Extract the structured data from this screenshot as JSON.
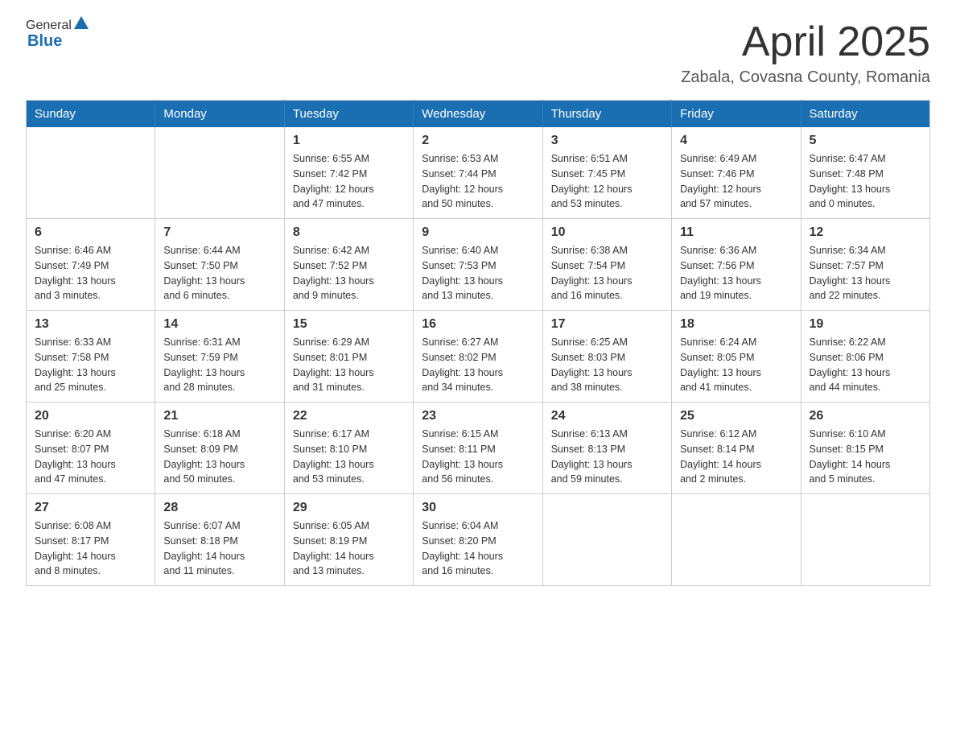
{
  "header": {
    "logo_general": "General",
    "logo_blue": "Blue",
    "month_title": "April 2025",
    "location": "Zabala, Covasna County, Romania"
  },
  "calendar": {
    "days_of_week": [
      "Sunday",
      "Monday",
      "Tuesday",
      "Wednesday",
      "Thursday",
      "Friday",
      "Saturday"
    ],
    "weeks": [
      [
        {
          "day": "",
          "info": ""
        },
        {
          "day": "",
          "info": ""
        },
        {
          "day": "1",
          "info": "Sunrise: 6:55 AM\nSunset: 7:42 PM\nDaylight: 12 hours\nand 47 minutes."
        },
        {
          "day": "2",
          "info": "Sunrise: 6:53 AM\nSunset: 7:44 PM\nDaylight: 12 hours\nand 50 minutes."
        },
        {
          "day": "3",
          "info": "Sunrise: 6:51 AM\nSunset: 7:45 PM\nDaylight: 12 hours\nand 53 minutes."
        },
        {
          "day": "4",
          "info": "Sunrise: 6:49 AM\nSunset: 7:46 PM\nDaylight: 12 hours\nand 57 minutes."
        },
        {
          "day": "5",
          "info": "Sunrise: 6:47 AM\nSunset: 7:48 PM\nDaylight: 13 hours\nand 0 minutes."
        }
      ],
      [
        {
          "day": "6",
          "info": "Sunrise: 6:46 AM\nSunset: 7:49 PM\nDaylight: 13 hours\nand 3 minutes."
        },
        {
          "day": "7",
          "info": "Sunrise: 6:44 AM\nSunset: 7:50 PM\nDaylight: 13 hours\nand 6 minutes."
        },
        {
          "day": "8",
          "info": "Sunrise: 6:42 AM\nSunset: 7:52 PM\nDaylight: 13 hours\nand 9 minutes."
        },
        {
          "day": "9",
          "info": "Sunrise: 6:40 AM\nSunset: 7:53 PM\nDaylight: 13 hours\nand 13 minutes."
        },
        {
          "day": "10",
          "info": "Sunrise: 6:38 AM\nSunset: 7:54 PM\nDaylight: 13 hours\nand 16 minutes."
        },
        {
          "day": "11",
          "info": "Sunrise: 6:36 AM\nSunset: 7:56 PM\nDaylight: 13 hours\nand 19 minutes."
        },
        {
          "day": "12",
          "info": "Sunrise: 6:34 AM\nSunset: 7:57 PM\nDaylight: 13 hours\nand 22 minutes."
        }
      ],
      [
        {
          "day": "13",
          "info": "Sunrise: 6:33 AM\nSunset: 7:58 PM\nDaylight: 13 hours\nand 25 minutes."
        },
        {
          "day": "14",
          "info": "Sunrise: 6:31 AM\nSunset: 7:59 PM\nDaylight: 13 hours\nand 28 minutes."
        },
        {
          "day": "15",
          "info": "Sunrise: 6:29 AM\nSunset: 8:01 PM\nDaylight: 13 hours\nand 31 minutes."
        },
        {
          "day": "16",
          "info": "Sunrise: 6:27 AM\nSunset: 8:02 PM\nDaylight: 13 hours\nand 34 minutes."
        },
        {
          "day": "17",
          "info": "Sunrise: 6:25 AM\nSunset: 8:03 PM\nDaylight: 13 hours\nand 38 minutes."
        },
        {
          "day": "18",
          "info": "Sunrise: 6:24 AM\nSunset: 8:05 PM\nDaylight: 13 hours\nand 41 minutes."
        },
        {
          "day": "19",
          "info": "Sunrise: 6:22 AM\nSunset: 8:06 PM\nDaylight: 13 hours\nand 44 minutes."
        }
      ],
      [
        {
          "day": "20",
          "info": "Sunrise: 6:20 AM\nSunset: 8:07 PM\nDaylight: 13 hours\nand 47 minutes."
        },
        {
          "day": "21",
          "info": "Sunrise: 6:18 AM\nSunset: 8:09 PM\nDaylight: 13 hours\nand 50 minutes."
        },
        {
          "day": "22",
          "info": "Sunrise: 6:17 AM\nSunset: 8:10 PM\nDaylight: 13 hours\nand 53 minutes."
        },
        {
          "day": "23",
          "info": "Sunrise: 6:15 AM\nSunset: 8:11 PM\nDaylight: 13 hours\nand 56 minutes."
        },
        {
          "day": "24",
          "info": "Sunrise: 6:13 AM\nSunset: 8:13 PM\nDaylight: 13 hours\nand 59 minutes."
        },
        {
          "day": "25",
          "info": "Sunrise: 6:12 AM\nSunset: 8:14 PM\nDaylight: 14 hours\nand 2 minutes."
        },
        {
          "day": "26",
          "info": "Sunrise: 6:10 AM\nSunset: 8:15 PM\nDaylight: 14 hours\nand 5 minutes."
        }
      ],
      [
        {
          "day": "27",
          "info": "Sunrise: 6:08 AM\nSunset: 8:17 PM\nDaylight: 14 hours\nand 8 minutes."
        },
        {
          "day": "28",
          "info": "Sunrise: 6:07 AM\nSunset: 8:18 PM\nDaylight: 14 hours\nand 11 minutes."
        },
        {
          "day": "29",
          "info": "Sunrise: 6:05 AM\nSunset: 8:19 PM\nDaylight: 14 hours\nand 13 minutes."
        },
        {
          "day": "30",
          "info": "Sunrise: 6:04 AM\nSunset: 8:20 PM\nDaylight: 14 hours\nand 16 minutes."
        },
        {
          "day": "",
          "info": ""
        },
        {
          "day": "",
          "info": ""
        },
        {
          "day": "",
          "info": ""
        }
      ]
    ]
  }
}
